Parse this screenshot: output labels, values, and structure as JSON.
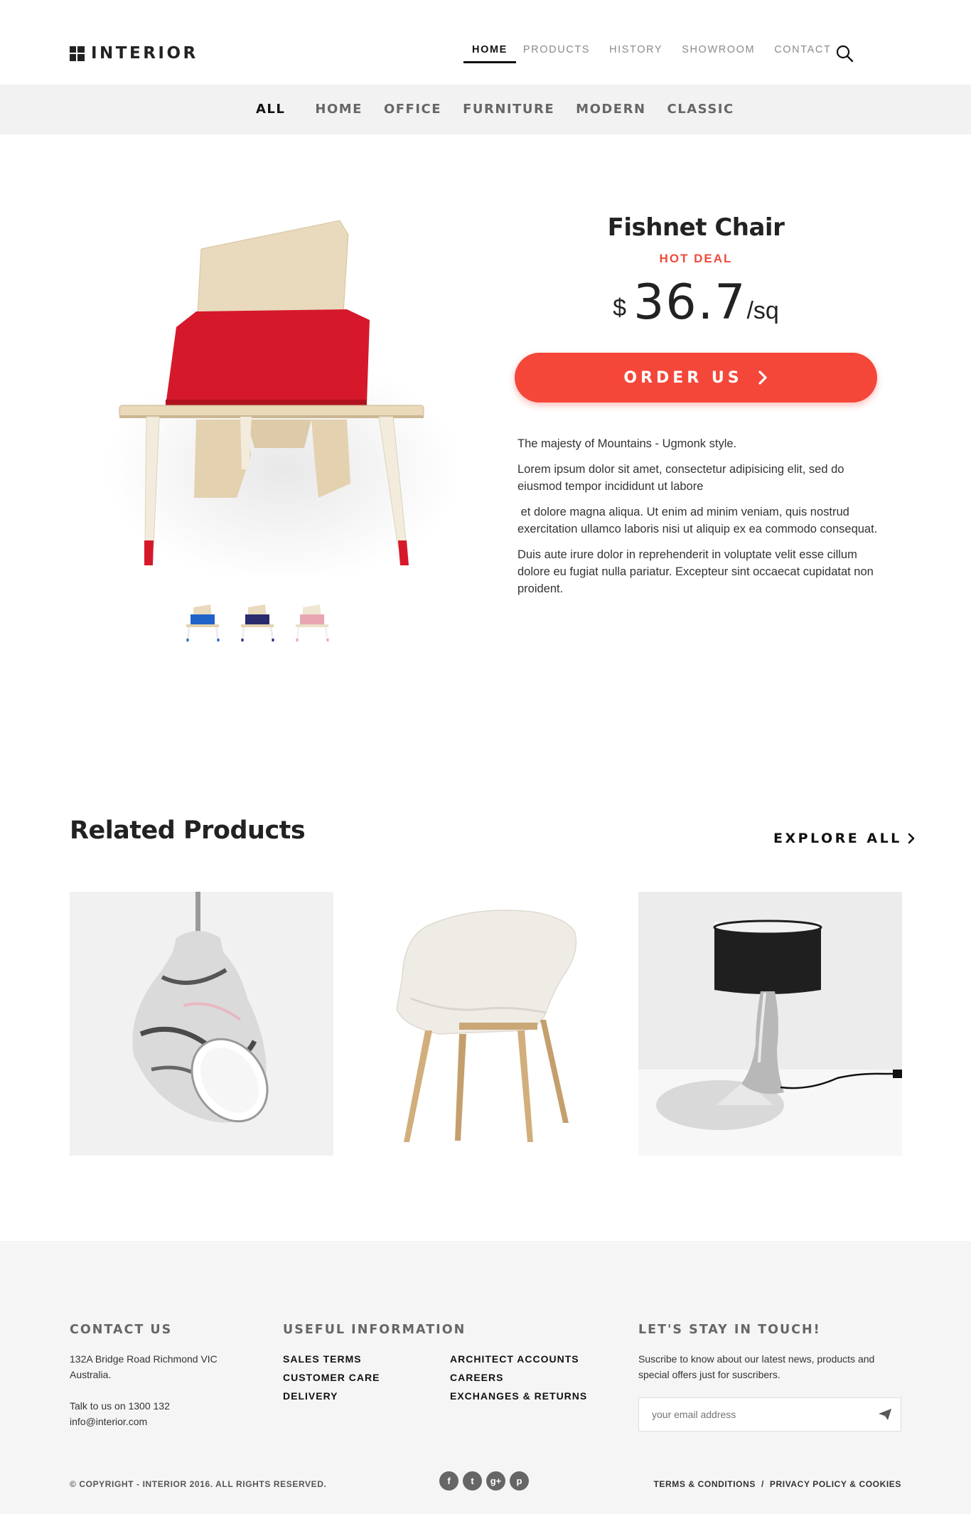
{
  "brand": {
    "name": "INTERIOR"
  },
  "topnav": {
    "items": [
      {
        "label": "HOME",
        "active": true
      },
      {
        "label": "PRODUCTS"
      },
      {
        "label": "HISTORY"
      },
      {
        "label": "SHOWROOM"
      },
      {
        "label": "CONTACT"
      }
    ],
    "search_icon": "search-icon"
  },
  "categories": {
    "items": [
      {
        "label": "ALL",
        "active": true
      },
      {
        "label": "HOME"
      },
      {
        "label": "OFFICE"
      },
      {
        "label": "FURNITURE"
      },
      {
        "label": "MODERN"
      },
      {
        "label": "CLASSIC"
      }
    ]
  },
  "product": {
    "title": "Fishnet Chair",
    "badge": "HOT DEAL",
    "currency": "$",
    "price": "36.7",
    "unit": "/sq",
    "order_label": "ORDER US",
    "thumb_colors": [
      "#1f63c9",
      "#2a2a6e",
      "#e7a6b1"
    ],
    "cushion_color": "#d6182b",
    "description": [
      "The majesty of Mountains - Ugmonk style.",
      "Lorem ipsum dolor sit amet, consectetur adipisicing elit, sed do eiusmod tempor incididunt ut labore",
      " et dolore magna aliqua. Ut enim ad minim veniam, quis nostrud exercitation ullamco laboris nisi ut aliquip ex ea commodo consequat.",
      "Duis aute irure dolor in reprehenderit in voluptate velit esse cillum dolore eu fugiat nulla pariatur. Excepteur sint occaecat cupidatat non proident."
    ]
  },
  "related": {
    "title": "Related Products",
    "explore_label": "EXPLORE ALL"
  },
  "footer": {
    "contact": {
      "heading": "CONTACT US",
      "address_line1": "132A Bridge Road Richmond VIC",
      "address_line2": "Australia.",
      "phone": "Talk to us on 1300 132",
      "email": "info@interior.com"
    },
    "useful": {
      "heading": "USEFUL INFORMATION",
      "col1": [
        "SALES TERMS",
        "CUSTOMER CARE",
        "DELIVERY"
      ],
      "col2": [
        "ARCHITECT ACCOUNTS",
        "CAREERS",
        "EXCHANGES & RETURNS"
      ]
    },
    "newsletter": {
      "heading": "LET'S STAY IN TOUCH!",
      "text_line1": "Suscribe to know about our latest news, products and",
      "text_line2": "special offers just for suscribers.",
      "placeholder": "your email address"
    },
    "copyright": "© COPYRIGHT - INTERIOR 2016. ALL RIGHTS RESERVED.",
    "socials": [
      {
        "icon": "facebook-icon",
        "glyph": "f"
      },
      {
        "icon": "twitter-icon",
        "glyph": "t"
      },
      {
        "icon": "google-plus-icon",
        "glyph": "g+"
      },
      {
        "icon": "pinterest-icon",
        "glyph": "p"
      }
    ],
    "legal": {
      "terms": "TERMS & CONDITIONS",
      "sep": "/",
      "privacy": "PRIVACY POLICY & COOKIES"
    }
  },
  "colors": {
    "accent": "#f4473a",
    "deal": "#f04a3a",
    "catbar_bg": "#f2f2f2",
    "footer_bg": "#f5f5f5"
  }
}
